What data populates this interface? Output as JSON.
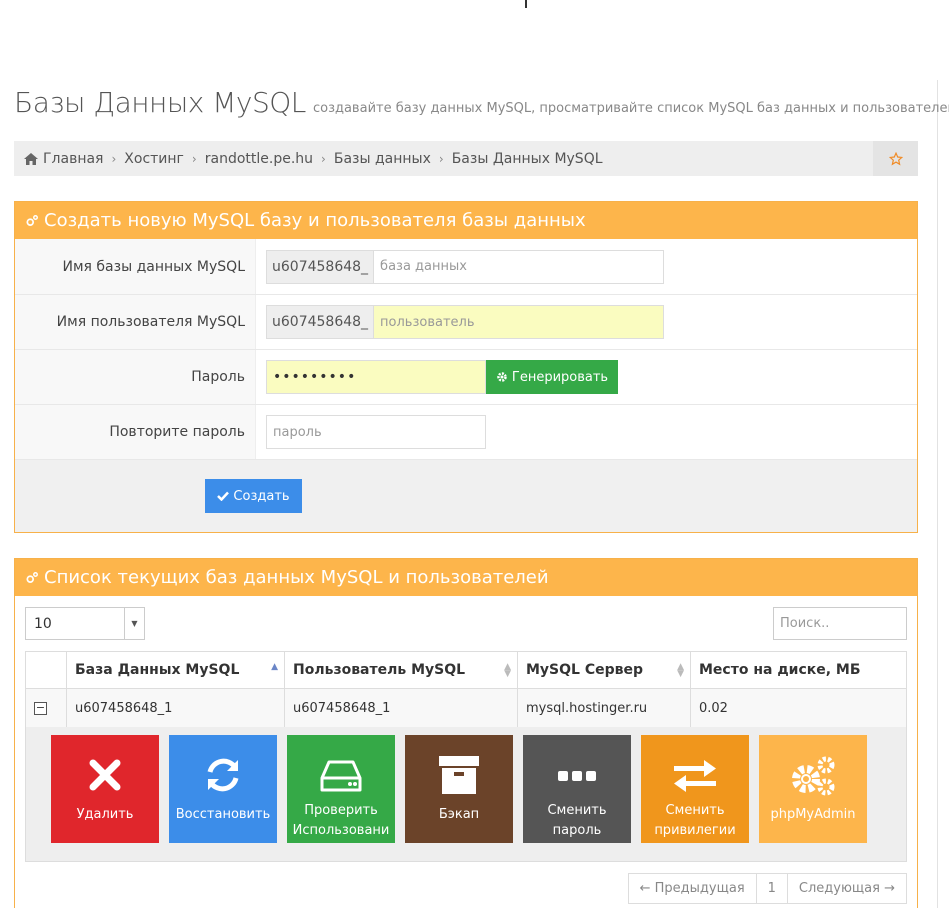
{
  "header": {
    "title": "Базы Данных MySQL",
    "subtitle": "создавайте базу данных MySQL, просматривайте список MySQL баз данных и пользователей"
  },
  "breadcrumb": [
    {
      "label": "Главная"
    },
    {
      "label": "Хостинг"
    },
    {
      "label": "randottle.pe.hu"
    },
    {
      "label": "Базы данных"
    },
    {
      "label": "Базы Данных MySQL"
    }
  ],
  "create_panel": {
    "title": "Создать новую MySQL базу и пользователя базы данных",
    "db_name": {
      "label": "Имя базы данных MySQL",
      "prefix": "u607458648_",
      "placeholder": "база данных"
    },
    "db_user": {
      "label": "Имя пользователя MySQL",
      "prefix": "u607458648_",
      "placeholder": "пользователь"
    },
    "password": {
      "label": "Пароль",
      "value": "•••••••••",
      "generate_label": "Генерировать"
    },
    "repeat_password": {
      "label": "Повторите пароль",
      "placeholder": "пароль"
    },
    "submit_label": "Создать"
  },
  "list_panel": {
    "title": "Список текущих баз данных MySQL и пользователей",
    "page_length": "10",
    "search_placeholder": "Поиск..",
    "columns": [
      "База Данных MySQL",
      "Пользователь MySQL",
      "MySQL Сервер",
      "Место на диске, МБ"
    ],
    "rows": [
      {
        "database": "u607458648_1",
        "user": "u607458648_1",
        "server": "mysql.hostinger.ru",
        "disk": "0.02"
      }
    ],
    "actions": [
      {
        "label": "Удалить",
        "color": "#e0262c"
      },
      {
        "label": "Восстановить",
        "color": "#3c8de9"
      },
      {
        "label1": "Проверить",
        "label2": "Использовани",
        "color": "#35a947"
      },
      {
        "label": "Бэкап",
        "color": "#6b4329"
      },
      {
        "label1": "Сменить",
        "label2": "пароль",
        "color": "#555555"
      },
      {
        "label1": "Сменить",
        "label2": "привилегии",
        "color": "#f0961c"
      },
      {
        "label": "phpMyAdmin",
        "color": "#fdb54b"
      }
    ],
    "pagination": {
      "prev": "← Предыдущая",
      "page": "1",
      "next": "Следующая →"
    }
  }
}
